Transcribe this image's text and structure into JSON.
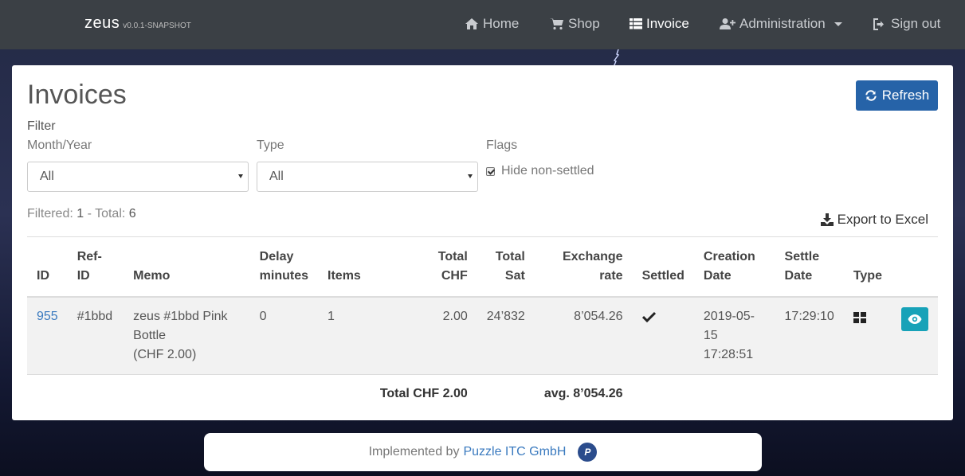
{
  "navbar": {
    "brand": "zeus",
    "version": "v0.0.1-SNAPSHOT",
    "items": [
      {
        "label": "Home",
        "icon": "home-icon"
      },
      {
        "label": "Shop",
        "icon": "cart-icon"
      },
      {
        "label": "Invoice",
        "icon": "list-icon",
        "active": true
      },
      {
        "label": "Administration",
        "icon": "user-plus-icon"
      },
      {
        "label": "Sign out",
        "icon": "sign-out-icon"
      }
    ]
  },
  "page": {
    "title": "Invoices",
    "refresh_label": "Refresh",
    "filter_label": "Filter",
    "month_year_label": "Month/Year",
    "month_year_value": "All",
    "type_label": "Type",
    "type_value": "All",
    "flags_label": "Flags",
    "hide_non_settled_label": "Hide non-settled",
    "hide_non_settled_checked": true,
    "filtered_prefix": "Filtered: ",
    "filtered_count": "1",
    "total_prefix": " - Total: ",
    "total_count": "6",
    "export_label": "Export to Excel"
  },
  "table": {
    "headers": {
      "id": "ID",
      "ref_id": "Ref-ID",
      "memo": "Memo",
      "delay_1": "Delay",
      "delay_2": "minutes",
      "items": "Items",
      "total_chf_1": "Total",
      "total_chf_2": "CHF",
      "total_sat_1": "Total",
      "total_sat_2": "Sat",
      "exchange_1": "Exchange",
      "exchange_2": "rate",
      "settled": "Settled",
      "creation_1": "Creation",
      "creation_2": "Date",
      "settle_1": "Settle",
      "settle_2": "Date",
      "type": "Type"
    },
    "rows": [
      {
        "id": "955",
        "ref_id": "#1bbd",
        "memo_1": "zeus #1bbd Pink Bottle",
        "memo_2": "(CHF 2.00)",
        "delay": "0",
        "items": "1",
        "total_chf": "2.00",
        "total_sat": "24’832",
        "exchange_rate": "8’054.26",
        "settled": true,
        "creation_1": "2019-05-15",
        "creation_2": "17:28:51",
        "settle_date": "17:29:10",
        "type_icon": "windows-icon"
      }
    ],
    "footer": {
      "total_chf": "Total CHF 2.00",
      "avg_rate": "avg. 8’054.26"
    }
  },
  "footer": {
    "prefix": "Implemented by",
    "link": "Puzzle ITC GmbH"
  },
  "colors": {
    "navbar": "#3b4045",
    "primary": "#2663a8",
    "info": "#17a2b8",
    "link": "#3a7abf"
  }
}
